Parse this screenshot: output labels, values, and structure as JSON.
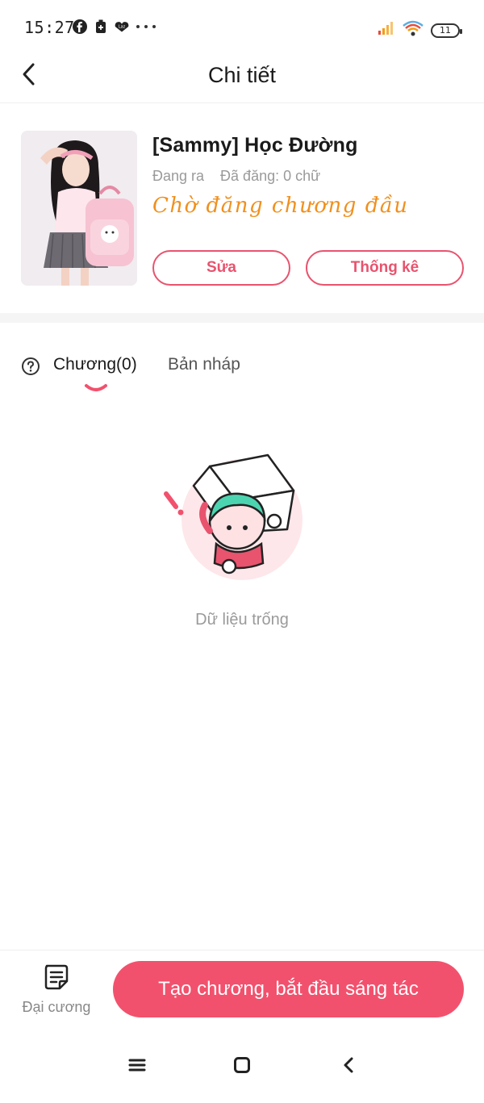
{
  "status_bar": {
    "time": "15:27",
    "battery": "11",
    "left_icons": [
      "facebook-icon",
      "battery-saver-icon",
      "lazada-icon",
      "more-dots-icon"
    ],
    "right_icons": [
      "signal-icon",
      "wifi-icon",
      "battery-icon"
    ]
  },
  "header": {
    "title": "Chi tiết",
    "back_icon": "chevron-left-icon"
  },
  "story": {
    "title": "[Sammy] Học Đường",
    "status_label": "Đang ra",
    "word_count_label": "Đã đăng: 0 chữ",
    "publish_status": "Chờ đăng chương đầu",
    "edit_button": "Sửa",
    "stats_button": "Thống kê"
  },
  "tabs": {
    "help_icon": "question-circle-icon",
    "items": [
      {
        "label": "Chương(0)",
        "active": true
      },
      {
        "label": "Bản nháp",
        "active": false
      }
    ]
  },
  "empty_state": {
    "text": "Dữ liệu trống"
  },
  "bottom_bar": {
    "outline_label": "Đại cương",
    "create_button": "Tạo chương, bắt đầu sáng tác"
  },
  "nav_bar": {
    "icons": [
      "menu-icon",
      "home-square-icon",
      "back-chevron-icon"
    ]
  },
  "colors": {
    "accent": "#f2516d",
    "accent_border": "#e8536e",
    "status_orange": "#f0901e",
    "muted_text": "#9a9a9a"
  }
}
